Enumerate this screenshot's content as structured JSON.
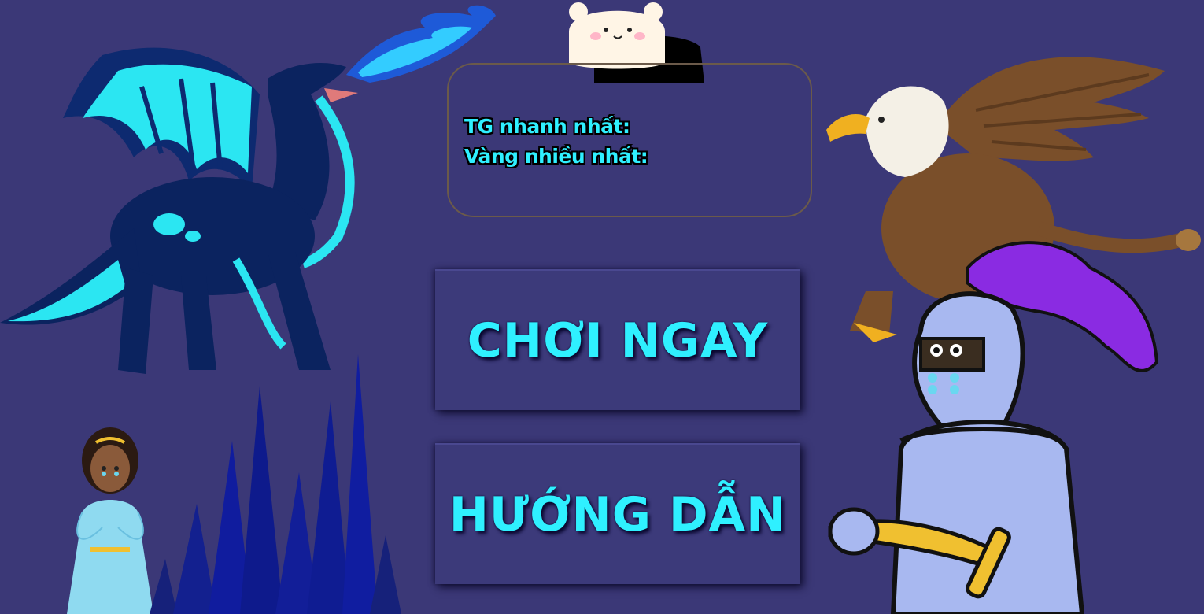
{
  "stats": {
    "fastest_time_label": "TG nhanh nhất:",
    "most_gold_label": "Vàng nhiều nhất:"
  },
  "menu": {
    "play_label": "CHƠI NGAY",
    "guide_label": "HƯỚNG DẪN"
  },
  "colors": {
    "background": "#3b3877",
    "accent_text": "#2ff0ff",
    "button_bg": "#3c3a7a"
  },
  "icons": [
    "bear-mascot-icon",
    "dragon-illustration",
    "griffin-illustration",
    "knight-illustration",
    "princess-illustration",
    "crystal-spires-illustration"
  ]
}
